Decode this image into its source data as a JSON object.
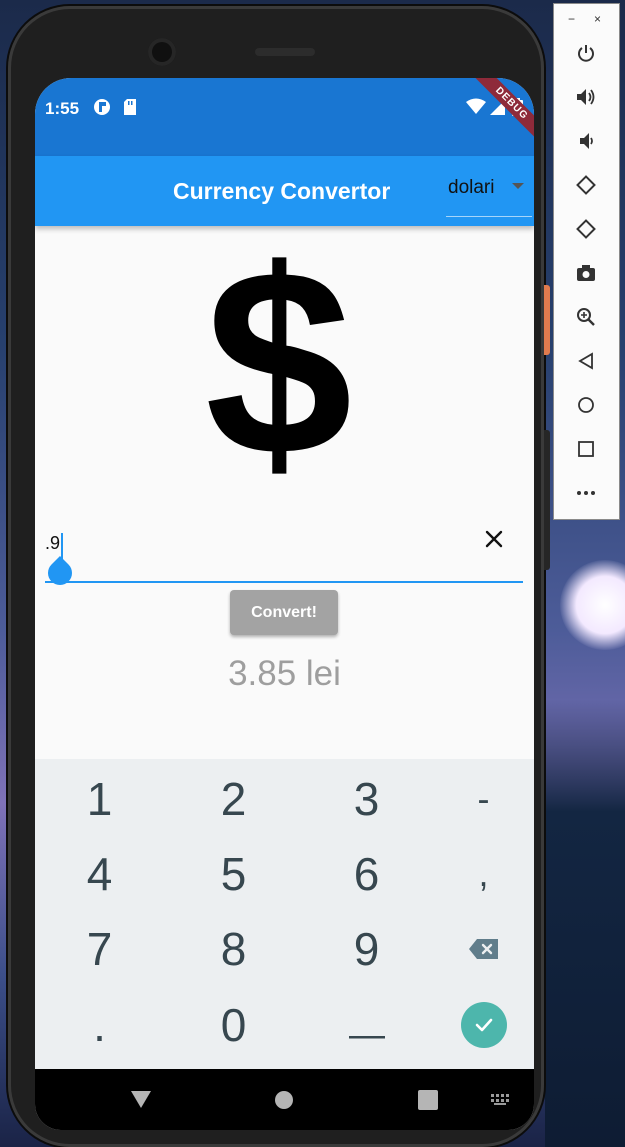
{
  "status_bar": {
    "time": "1:55",
    "debug_banner": "DEBUG"
  },
  "app_bar": {
    "title": "Currency Convertor",
    "currency_dropdown": {
      "selected": "dolari"
    }
  },
  "currency_symbol": "$",
  "amount_input": {
    "value": ".9"
  },
  "convert_button": {
    "label": "Convert!"
  },
  "result": {
    "text": "3.85 lei"
  },
  "keyboard": {
    "rows": [
      [
        "1",
        "2",
        "3",
        "-"
      ],
      [
        "4",
        "5",
        "6",
        ","
      ],
      [
        "7",
        "8",
        "9",
        "backspace"
      ],
      [
        ".",
        "0",
        "_",
        "done"
      ]
    ]
  },
  "nav_bar": {
    "buttons": [
      "back",
      "home",
      "recents"
    ]
  },
  "emulator_toolbar": {
    "window_controls": [
      "−",
      "×"
    ],
    "buttons": [
      "power",
      "volume-up",
      "volume-down",
      "rotate-left",
      "rotate-right",
      "screenshot",
      "zoom",
      "back",
      "home",
      "overview",
      "more"
    ]
  },
  "colors": {
    "status_bar": "#1976d2",
    "app_bar": "#2196f3",
    "accent": "#2196f3",
    "convert_button": "#a3a3a3",
    "done_key": "#4db6ac",
    "keyboard_bg": "#eceff1"
  }
}
